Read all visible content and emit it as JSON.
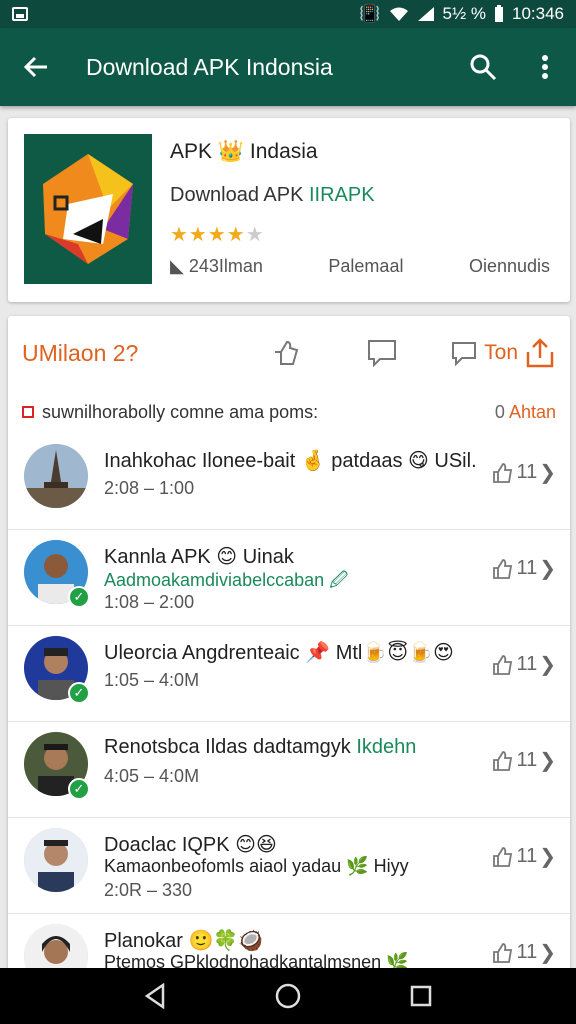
{
  "status_bar": {
    "signal_text": "5½ %",
    "time": "10:346"
  },
  "app_bar": {
    "title": "Download APK Indonsia"
  },
  "app_card": {
    "name_left": "APK",
    "name_right": "Indasia",
    "subtitle_plain": "Download APK ",
    "subtitle_highlight": "IIRAPK",
    "rating_full": "★★★★",
    "rating_half": "★",
    "rating_value": 4.5,
    "downloads": "243Ilman",
    "category": "Palemaal",
    "developer": "Oiennudis"
  },
  "feed": {
    "header_label": "UMilaon 2?",
    "share_label": "Ton",
    "notice_text": "suwnilhorabolly comne ama poms:",
    "notice_right_prefix": "0",
    "notice_right": "Ahtan",
    "rows": [
      {
        "name": "Inahkohac Ilonee-bait 🤞 patdaas 😋 USil.",
        "time": "2:08  –  1:00",
        "count": "11"
      },
      {
        "name": "Kannla APK 😊 Uinak",
        "line2": "Aadmoakamdiviabelccaban 🖉",
        "time": "1:08  –  2:00",
        "count": "11"
      },
      {
        "name": "Uleorcia Angdrenteaic 📌 Mtl🍺😇🍺😍",
        "time": "1:05  –  4:0M",
        "count": "11"
      },
      {
        "name": "Renotsbca Ildas dadtamgyk",
        "name_hl": "Ikdehn",
        "time": "4:05  –  4:0M",
        "count": "11"
      },
      {
        "name": "Doaclac IQPK 😊😆",
        "line2": "Kamaonbeofomls aiaol yadau 🌿 Hiyy",
        "time": "2:0R  –  330",
        "count": "11"
      },
      {
        "name": "Planokar 🙂🍀🥥",
        "line2": "Ptemos GPklodnohadkantalmsnen 🌿",
        "time": "",
        "count": "11"
      }
    ]
  },
  "colors": {
    "app_bar": "#0d5846",
    "status_bar": "#0d4a3d",
    "accent": "#e0621e",
    "green": "#1a8a5c",
    "star": "#f2a91a"
  }
}
